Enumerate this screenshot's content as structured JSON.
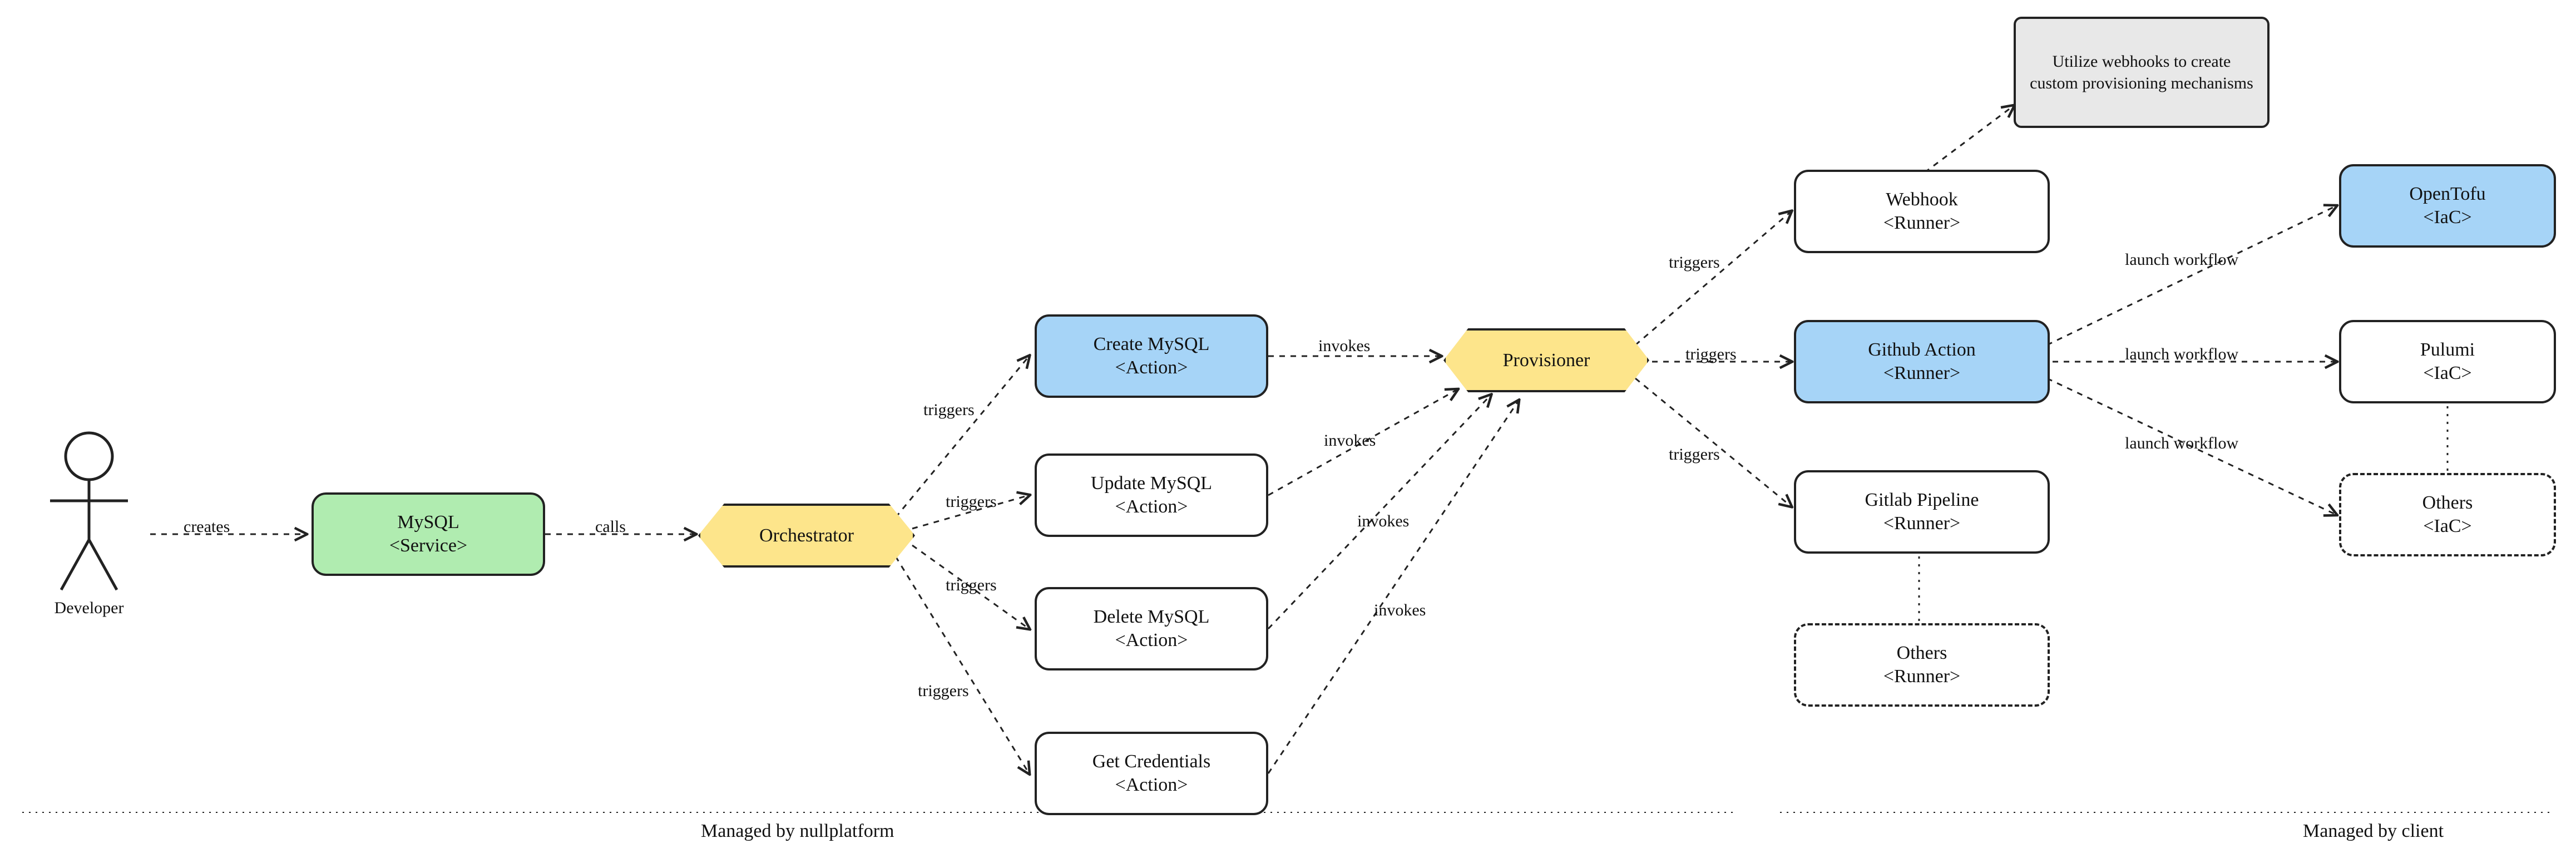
{
  "actor": {
    "label": "Developer"
  },
  "nodes": {
    "mysql_service": {
      "title": "MySQL",
      "stereo": "<Service>"
    },
    "orchestrator": {
      "title": "Orchestrator"
    },
    "create_mysql": {
      "title": "Create MySQL",
      "stereo": "<Action>"
    },
    "update_mysql": {
      "title": "Update MySQL",
      "stereo": "<Action>"
    },
    "delete_mysql": {
      "title": "Delete MySQL",
      "stereo": "<Action>"
    },
    "get_credentials": {
      "title": "Get Credentials",
      "stereo": "<Action>"
    },
    "provisioner": {
      "title": "Provisioner"
    },
    "webhook_runner": {
      "title": "Webhook",
      "stereo": "<Runner>"
    },
    "github_runner": {
      "title": "Github Action",
      "stereo": "<Runner>"
    },
    "gitlab_runner": {
      "title": "Gitlab Pipeline",
      "stereo": "<Runner>"
    },
    "others_runner": {
      "title": "Others",
      "stereo": "<Runner>"
    },
    "opentofu_iac": {
      "title": "OpenTofu",
      "stereo": "<IaC>"
    },
    "pulumi_iac": {
      "title": "Pulumi",
      "stereo": "<IaC>"
    },
    "others_iac": {
      "title": "Others",
      "stereo": "<IaC>"
    },
    "webhook_note": {
      "text": "Utilize webhooks to create custom provisioning mechanisms"
    }
  },
  "edges": {
    "creates": "creates",
    "calls": "calls",
    "triggers": "triggers",
    "invokes": "invokes",
    "launch_workflow": "launch workflow"
  },
  "zones": {
    "left": "Managed by nullplatform",
    "right": "Managed by client"
  }
}
